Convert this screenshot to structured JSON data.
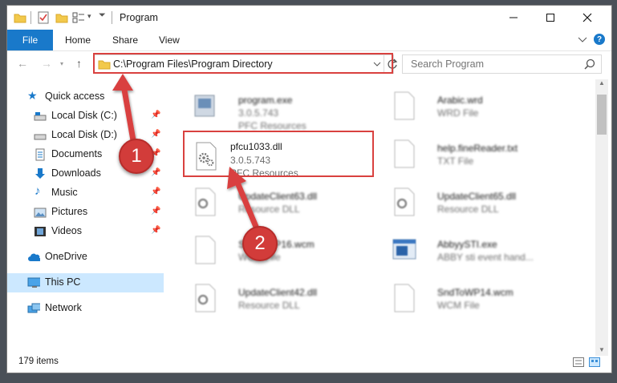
{
  "window": {
    "title": "Program",
    "controls": [
      "minimize-icon",
      "maximize-icon",
      "close-icon"
    ]
  },
  "ribbon": {
    "tabs": [
      "File",
      "Home",
      "Share",
      "View"
    ],
    "help_icon": "help-icon",
    "expand_icon": "chevron-down-icon"
  },
  "address": {
    "path": "C:\\Program Files\\Program Directory",
    "search_placeholder": "Search Program"
  },
  "navigation": {
    "items": [
      {
        "label": "Quick access",
        "icon": "star-icon",
        "pinned": false
      },
      {
        "label": "Local Disk (C:)",
        "icon": "drive-icon",
        "pinned": true
      },
      {
        "label": "Local Disk (D:)",
        "icon": "drive-icon",
        "pinned": true
      },
      {
        "label": "Documents",
        "icon": "document-icon",
        "pinned": true
      },
      {
        "label": "Downloads",
        "icon": "download-icon",
        "pinned": true
      },
      {
        "label": "Music",
        "icon": "music-icon",
        "pinned": true
      },
      {
        "label": "Pictures",
        "icon": "picture-icon",
        "pinned": true
      },
      {
        "label": "Videos",
        "icon": "video-icon",
        "pinned": true
      },
      {
        "label": "OneDrive",
        "icon": "cloud-icon",
        "pinned": false
      },
      {
        "label": "This PC",
        "icon": "computer-icon",
        "pinned": false,
        "selected": true
      },
      {
        "label": "Network",
        "icon": "network-icon",
        "pinned": false
      }
    ]
  },
  "files": [
    {
      "name": "program.exe",
      "line2": "3.0.5.743",
      "line3": "PFC Resources",
      "icon": "exe-icon"
    },
    {
      "name": "Arabic.wrd",
      "line2": "WRD File",
      "line3": "",
      "icon": "file-icon"
    },
    {
      "name": "pfcu1033.dll",
      "line2": "3.0.5.743",
      "line3": "PFC Resources",
      "icon": "gear-file-icon",
      "highlighted": true
    },
    {
      "name": "help.fineReader.txt",
      "line2": "TXT File",
      "line3": "",
      "icon": "file-icon"
    },
    {
      "name": "UpdateClient63.dll",
      "line2": "Resource DLL",
      "line3": "",
      "icon": "gear-file-icon"
    },
    {
      "name": "UpdateClient65.dll",
      "line2": "Resource DLL",
      "line3": "",
      "icon": "gear-file-icon"
    },
    {
      "name": "SndToWP16.wcm",
      "line2": "WCM File",
      "line3": "",
      "icon": "file-icon"
    },
    {
      "name": "AbbyySTI.exe",
      "line2": "ABBY sti event hand...",
      "line3": "",
      "icon": "window-icon"
    },
    {
      "name": "UpdateClient42.dll",
      "line2": "Resource DLL",
      "line3": "",
      "icon": "gear-file-icon"
    },
    {
      "name": "SndToWP14.wcm",
      "line2": "WCM File",
      "line3": "",
      "icon": "file-icon"
    }
  ],
  "status": {
    "count": "179 items"
  },
  "annotations": {
    "badge1": "1",
    "badge2": "2",
    "highlight_color": "#d9413f"
  },
  "colors": {
    "accent": "#1979ca",
    "selected_bg": "#cce8ff",
    "folder": "#f2c94c"
  }
}
